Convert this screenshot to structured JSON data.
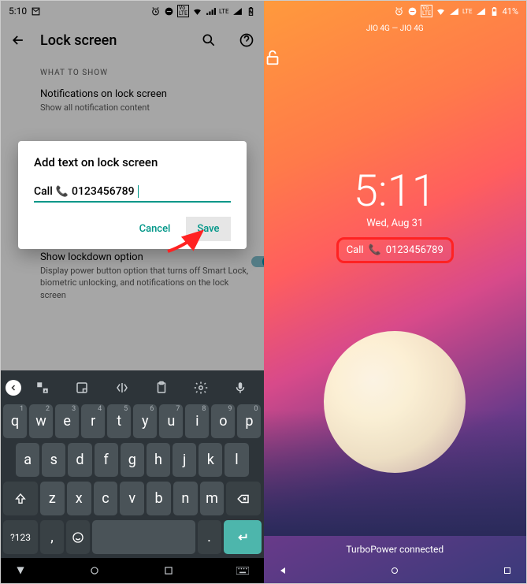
{
  "left": {
    "status": {
      "time": "5:10",
      "icons": [
        "mail",
        "alarm",
        "dnd",
        "volte",
        "wifi",
        "signal",
        "lte",
        "signal2",
        "battery"
      ]
    },
    "appbar": {
      "title": "Lock screen"
    },
    "section_header": "WHAT TO SHOW",
    "settings": {
      "notifications": {
        "title": "Notifications on lock screen",
        "desc": "Show all notification content"
      },
      "lockdown": {
        "title": "Show lockdown option",
        "desc": "Display power button option that turns off Smart Lock, biometric unlocking, and notifications on the lock screen"
      }
    },
    "dialog": {
      "title": "Add text on lock screen",
      "input_prefix": "Call",
      "input_number": "0123456789",
      "cancel": "Cancel",
      "save": "Save"
    },
    "keyboard": {
      "row1": [
        "q",
        "w",
        "e",
        "r",
        "t",
        "y",
        "u",
        "i",
        "o",
        "p"
      ],
      "row1sup": [
        "1",
        "2",
        "3",
        "4",
        "5",
        "6",
        "7",
        "8",
        "9",
        "0"
      ],
      "row2": [
        "a",
        "s",
        "d",
        "f",
        "g",
        "h",
        "j",
        "k",
        "l"
      ],
      "row3": [
        "z",
        "x",
        "c",
        "v",
        "b",
        "n",
        "m"
      ],
      "num_label": "?123"
    }
  },
  "right": {
    "status": {
      "battery_pct": "41%",
      "icons": [
        "alarm",
        "dnd",
        "volte",
        "wifi",
        "signal",
        "lte",
        "signal2",
        "battery"
      ]
    },
    "carrier": "JIO 4G — JIO 4G",
    "time": "5:11",
    "date": "Wed, Aug 31",
    "lock_message_prefix": "Call",
    "lock_message_number": "0123456789",
    "bottom": "TurboPower connected"
  }
}
